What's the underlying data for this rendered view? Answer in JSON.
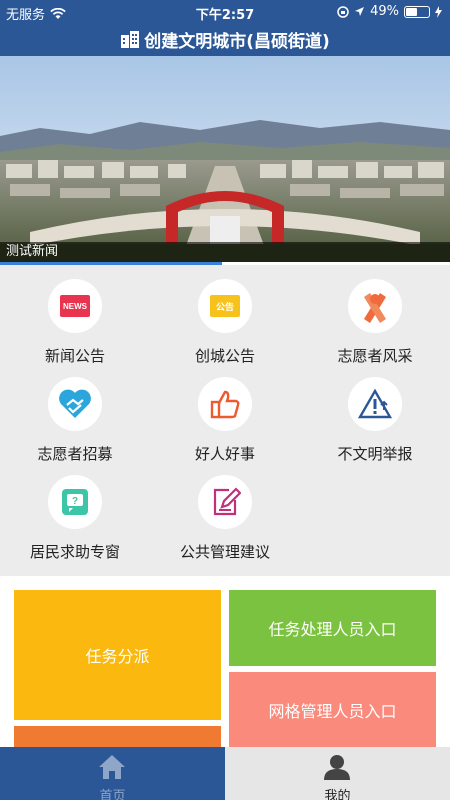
{
  "status_bar": {
    "carrier": "无服务",
    "time": "下午2:57",
    "battery": "49%",
    "battery_level": 0.49
  },
  "header": {
    "title": "创建文明城市(昌硕街道)"
  },
  "banner": {
    "caption": "测试新闻"
  },
  "icon_badges": {
    "news": "NEWS",
    "announce": "公告"
  },
  "grid": [
    {
      "label": "新闻公告",
      "icon": "news-icon"
    },
    {
      "label": "创城公告",
      "icon": "announcement-icon"
    },
    {
      "label": "志愿者风采",
      "icon": "ribbon-icon"
    },
    {
      "label": "志愿者招募",
      "icon": "heart-hands-icon"
    },
    {
      "label": "好人好事",
      "icon": "thumbs-up-icon"
    },
    {
      "label": "不文明举报",
      "icon": "warning-icon"
    },
    {
      "label": "居民求助专窗",
      "icon": "help-window-icon"
    },
    {
      "label": "公共管理建议",
      "icon": "edit-note-icon"
    }
  ],
  "tiles": {
    "task_dispatch": "任务分派",
    "task_handler": "任务处理人员入口",
    "grid_manager": "网格管理人员入口"
  },
  "tabbar": {
    "home": "首页",
    "mine": "我的"
  },
  "colors": {
    "header_bg": "#2b5797",
    "tile_yellow": "#fbb90f",
    "tile_green": "#7cc241",
    "tile_pink": "#fa8a7c",
    "tile_orange": "#f07a32",
    "accent_blue": "#3a82d8"
  }
}
